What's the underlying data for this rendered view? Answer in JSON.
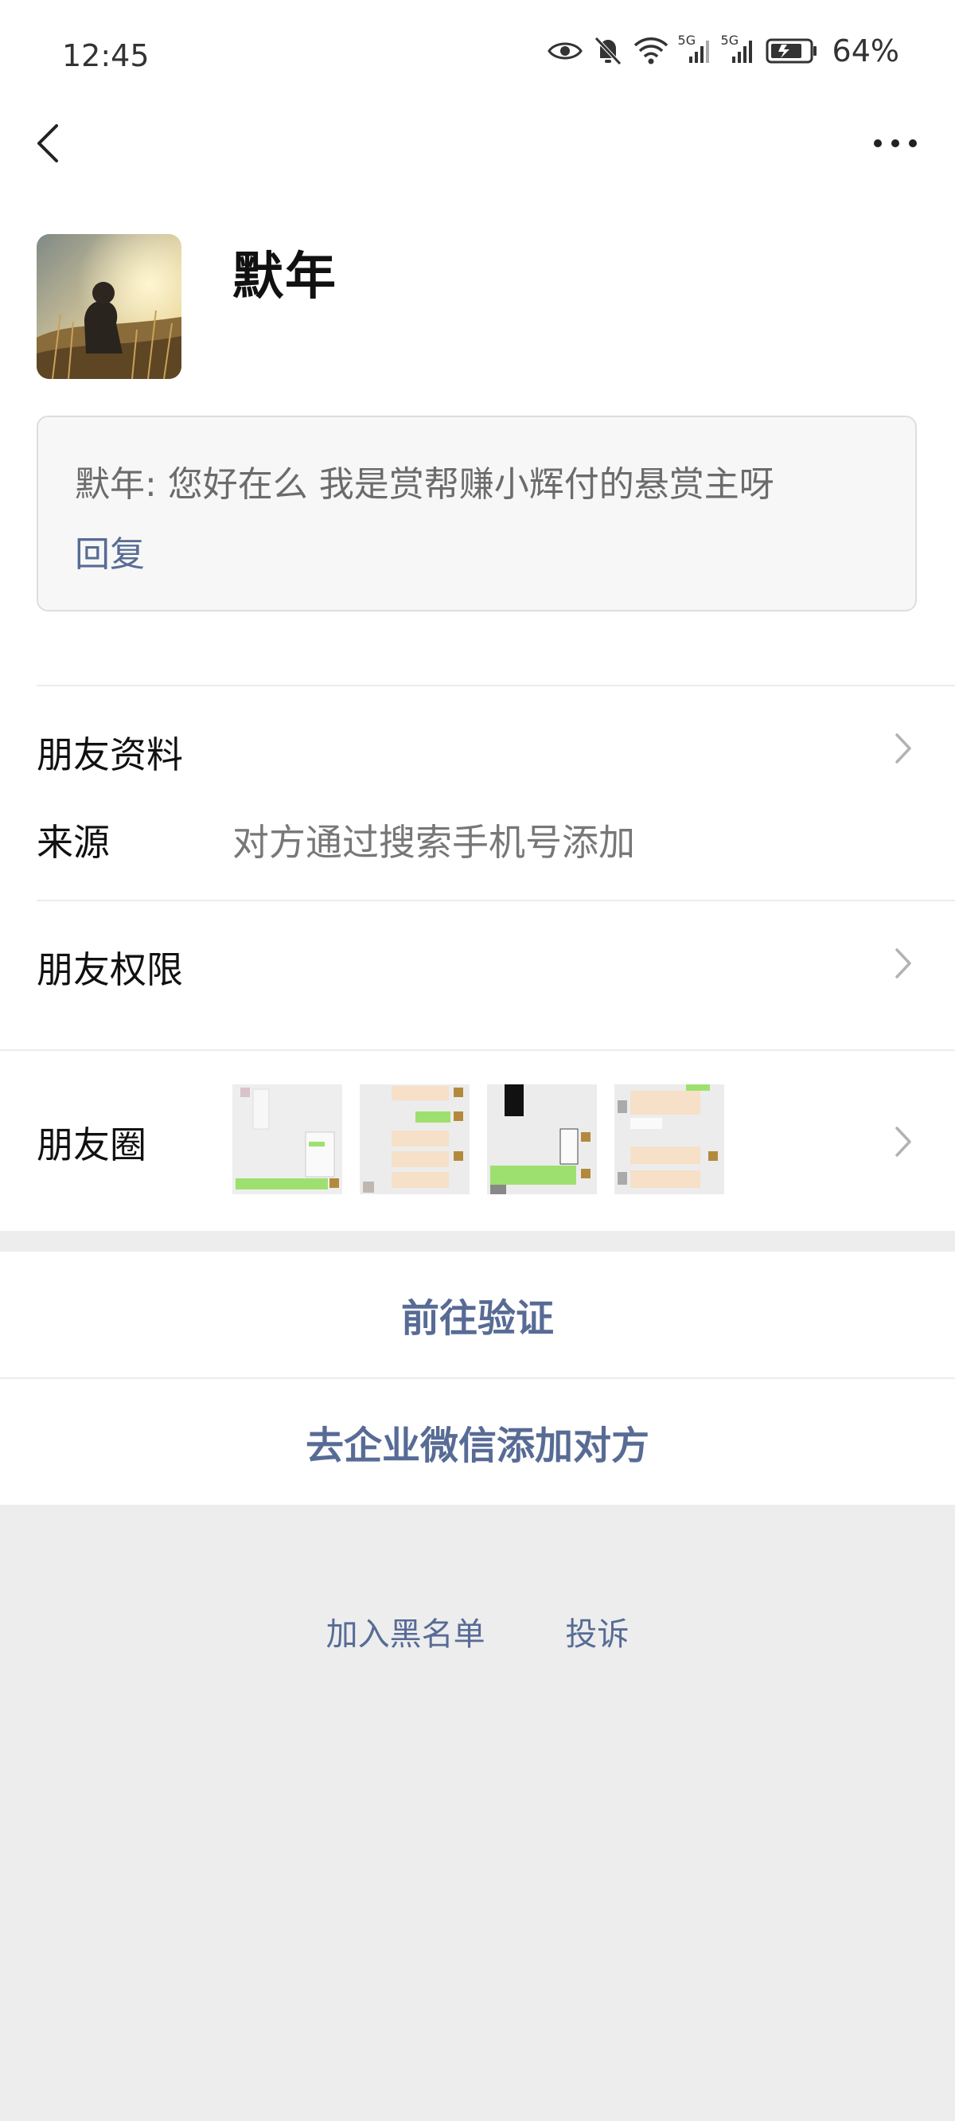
{
  "status_bar": {
    "time": "12:45",
    "signal_1_label": "5G",
    "signal_2_label": "5G",
    "battery_percent": "64%",
    "icons": [
      "eye-icon",
      "mute-bell-icon",
      "wifi-icon",
      "cellular-signal-icon",
      "cellular-signal-icon",
      "battery-icon"
    ]
  },
  "header": {
    "back_icon": "chevron-left-icon",
    "more_icon": "more-dots-icon"
  },
  "profile": {
    "name": "默年"
  },
  "greeting": {
    "message": "默年: 您好在么 我是赏帮赚小辉付的悬赏主呀",
    "reply_label": "回复"
  },
  "rows": {
    "friend_info_label": "朋友资料",
    "source_label": "来源",
    "source_value": "对方通过搜索手机号添加",
    "permissions_label": "朋友权限"
  },
  "moments": {
    "label": "朋友圈",
    "thumbnails": [
      "thumbnail-1",
      "thumbnail-2",
      "thumbnail-3",
      "thumbnail-4"
    ]
  },
  "actions": {
    "verify_label": "前往验证",
    "enterprise_add_label": "去企业微信添加对方"
  },
  "footer": {
    "blacklist_label": "加入黑名单",
    "report_label": "投诉"
  },
  "colors": {
    "accent_link": "#576b95",
    "page_background": "#ededed",
    "card_background": "#ffffff"
  }
}
